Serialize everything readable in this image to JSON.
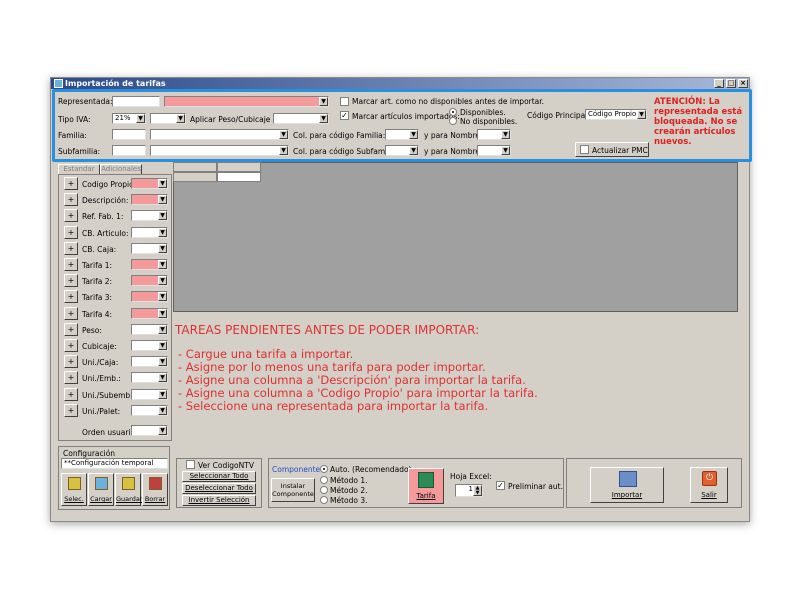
{
  "window": {
    "title": "Importación de tarifas",
    "min": "_",
    "max": "□",
    "close": "×"
  },
  "header": {
    "representada_label": "Representada:",
    "tipo_iva_label": "Tipo IVA:",
    "tipo_iva_value": "21%",
    "aplicar_label": "Aplicar Peso/Cubicaje a:",
    "familia_label": "Familia:",
    "subfamilia_label": "Subfamilia:",
    "col_familia_label": "Col. para código Familia:",
    "col_subfamilia_label": "Col. para código Subfamilia:",
    "y_para_nombre_label": "y para Nombre:",
    "marcar_no_disp_label": "Marcar art. como no disponibles antes de importar.",
    "marcar_importados_label": "Marcar artículos importados:",
    "disponibles_label": "Disponibles.",
    "no_disponibles_label": "No disponibles.",
    "codigo_principal_label": "Código Principal:",
    "codigo_principal_value": "Código Propio",
    "actualizar_pmc_label": "Actualizar PMC",
    "attention": "ATENCIÓN: La representada está bloqueada. No se crearán artículos nuevos."
  },
  "tabs": {
    "estandar": "Estandar",
    "adicionales": "Adicionales"
  },
  "fields": [
    {
      "label": "Codigo Propio:",
      "pink": true
    },
    {
      "label": "Descripción:",
      "pink": true
    },
    {
      "label": "Ref. Fab. 1:",
      "pink": false
    },
    {
      "label": "CB. Articulo:",
      "pink": false
    },
    {
      "label": "CB. Caja:",
      "pink": false
    },
    {
      "label": "Tarifa 1:",
      "pink": true
    },
    {
      "label": "Tarifa 2:",
      "pink": true
    },
    {
      "label": "Tarifa 3:",
      "pink": true
    },
    {
      "label": "Tarifa 4:",
      "pink": true
    },
    {
      "label": "Peso:",
      "pink": false
    },
    {
      "label": "Cubicaje:",
      "pink": false
    },
    {
      "label": "Uni./Caja:",
      "pink": false
    },
    {
      "label": "Uni./Emb.:",
      "pink": false
    },
    {
      "label": "Uni./Subemb.:",
      "pink": false
    },
    {
      "label": "Uni./Palet:",
      "pink": false
    }
  ],
  "orden_usuario_label": "Orden usuario:",
  "tasks": {
    "title": "TAREAS PENDIENTES ANTES DE PODER IMPORTAR:",
    "items": [
      "- Cargue una tarifa a importar.",
      "- Asigne por lo menos una tarifa para poder importar.",
      "- Asigne una columna a 'Descripción' para importar la tarifa.",
      "- Asigne una columna a 'Codigo Propio' para importar la tarifa.",
      "- Seleccione una representada para importar la tarifa."
    ]
  },
  "config": {
    "title": "Configuración",
    "value": "**Configuración temporal",
    "buttons": [
      "Selec.",
      "Cargar",
      "Guardar",
      "Borrar"
    ]
  },
  "bottom": {
    "ver_codigo_ntv": "Ver CodigoNTV",
    "seleccionar_todo": "Seleccionar Todo",
    "deseleccionar_todo": "Deseleccionar Todo",
    "invertir_seleccion": "Invertir Selección",
    "componente_label": "Componente:",
    "instalar_componente": "Instalar Componente",
    "auto_label": "Auto. (Recomendado)",
    "metodo1": "Método 1.",
    "metodo2": "Método 2.",
    "metodo3": "Método 3.",
    "tarifa_button": "Tarifa",
    "hoja_excel_label": "Hoja Excel:",
    "hoja_excel_value": "1",
    "preliminar_label": "Preliminar aut.",
    "importar_button": "Importar",
    "salir_button": "Salir"
  },
  "colors": {
    "accent": "#2b8fe0",
    "pink": "#f49a9a",
    "warning": "#e02020"
  }
}
